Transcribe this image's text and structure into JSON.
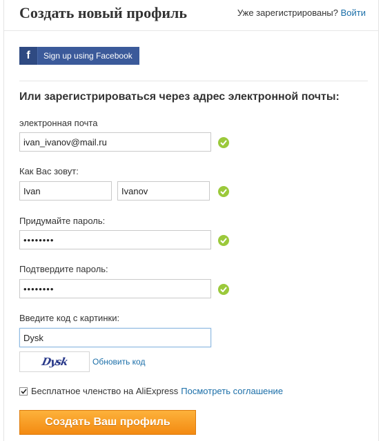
{
  "header": {
    "title": "Создать новый профиль",
    "registered_prompt": "Уже зарегистрированы?",
    "login_link": "Войти"
  },
  "facebook": {
    "icon": "facebook-f-icon",
    "label": "Sign up using Facebook",
    "color": "#3b5a9a"
  },
  "form": {
    "heading": "Или зарегистрироваться через адрес электронной почты:",
    "email": {
      "label": "электронная почта",
      "value": "ivan_ivanov@mail.ru",
      "valid": true
    },
    "name": {
      "label": "Как Вас зовут:",
      "first_value": "Ivan",
      "last_value": "Ivanov",
      "valid": true
    },
    "password": {
      "label": "Придумайте пароль:",
      "value": "••••••••",
      "valid": true
    },
    "confirm_password": {
      "label": "Подтвердите пароль:",
      "value": "••••••••",
      "valid": true
    },
    "captcha": {
      "label": "Введите код с картинки:",
      "value": "Dysk",
      "image_text": "Dysk",
      "refresh_link": "Обновить код"
    },
    "agreement": {
      "checked": true,
      "text": "Бесплатное членство на AliExpress",
      "link": "Посмотреть соглашение"
    },
    "submit_label": "Создать Ваш профиль"
  },
  "colors": {
    "valid_check": "#9bc93b",
    "link": "#1a6ea8",
    "submit": "#f38a12"
  }
}
